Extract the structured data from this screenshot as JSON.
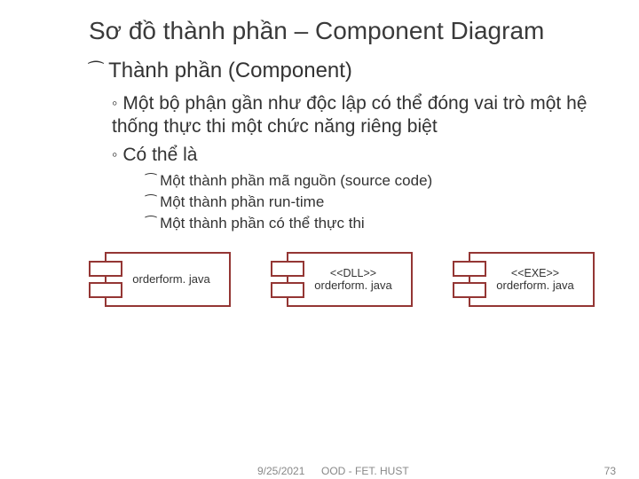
{
  "title": "Sơ đồ thành phần – Component Diagram",
  "level1": {
    "bullet": "⁀",
    "text": "Thành phần (Component)"
  },
  "level2": [
    {
      "bullet": "◦",
      "text": "Một bộ phận gần như độc lập có thể đóng vai trò một hệ thống thực thi một chức năng riêng biệt"
    },
    {
      "bullet": "◦",
      "text": "Có thể là"
    }
  ],
  "level3": [
    {
      "bullet": "⁀",
      "text": "Một thành phần mã nguồn (source code)"
    },
    {
      "bullet": "⁀",
      "text": "Một thành phần run-time"
    },
    {
      "bullet": "⁀",
      "text": "Một thành phần có thể thực thi"
    }
  ],
  "components": [
    {
      "stereotype": "",
      "name": "orderform. java"
    },
    {
      "stereotype": "<<DLL>>",
      "name": "orderform. java"
    },
    {
      "stereotype": "<<EXE>>",
      "name": "orderform. java"
    }
  ],
  "footer": {
    "date": "9/25/2021",
    "mid": "OOD - FET. HUST",
    "pagenum": "73"
  }
}
